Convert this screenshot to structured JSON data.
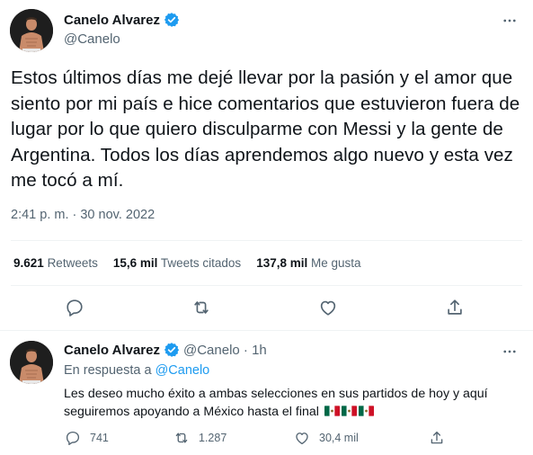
{
  "main_tweet": {
    "display_name": "Canelo Alvarez",
    "handle": "@Canelo",
    "text": "Estos últimos días me dejé llevar por la pasión y el amor que siento por mi país e hice comentarios que estuvieron fuera de lugar por lo que quiero disculparme con Messi y la gente de Argentina. Todos los días aprendemos algo nuevo y esta vez me tocó a mí.",
    "timestamp": "2:41 p. m. · 30 nov. 2022",
    "stats": {
      "retweets_count": "9.621",
      "retweets_label": "Retweets",
      "quotes_count": "15,6 mil",
      "quotes_label": "Tweets citados",
      "likes_count": "137,8 mil",
      "likes_label": "Me gusta"
    },
    "icons": [
      "more-icon",
      "reply-icon",
      "retweet-icon",
      "like-icon",
      "share-icon",
      "verified-badge-icon"
    ]
  },
  "reply_tweet": {
    "display_name": "Canelo Alvarez",
    "handle_time": "@Canelo · 1h",
    "reply_prefix": "En respuesta a",
    "reply_handle": "@Canelo",
    "text": "Les deseo mucho éxito a ambas selecciones en sus partidos de hoy y aquí seguiremos apoyando a México hasta el final",
    "counts": {
      "replies": "741",
      "retweets": "1.287",
      "likes": "30,4 mil"
    },
    "flags": [
      "mexico-flag-icon",
      "mexico-flag-icon",
      "mexico-flag-icon"
    ]
  },
  "colors": {
    "text_primary": "#0f1419",
    "text_secondary": "#536471",
    "accent_blue": "#1d9bf0",
    "divider": "#eff3f4"
  }
}
